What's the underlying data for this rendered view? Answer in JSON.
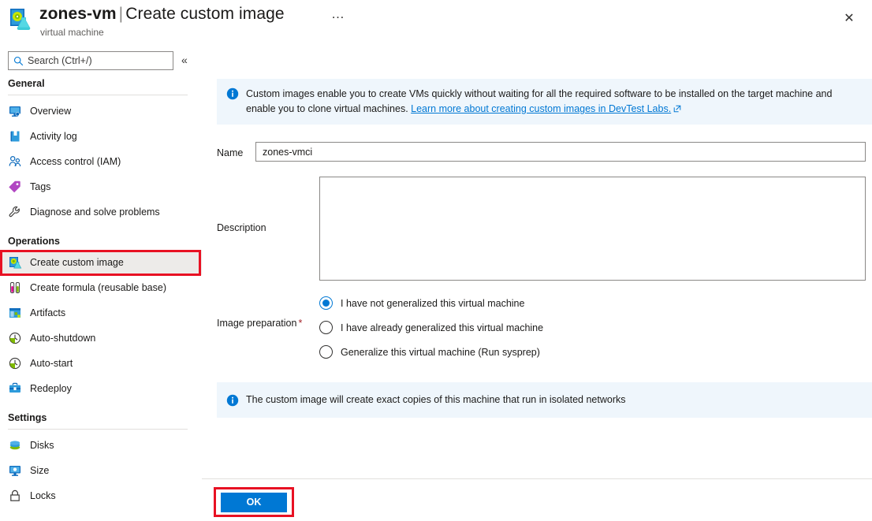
{
  "header": {
    "icon": "custom-image-icon",
    "vm_name": "zones-vm",
    "separator": "|",
    "blade_title": "Create custom image",
    "subtitle": "virtual machine",
    "ellipsis": "…",
    "close": "✕"
  },
  "sidebar": {
    "search": {
      "placeholder": "Search (Ctrl+/)",
      "value": "",
      "icon": "search-icon"
    },
    "collapse": {
      "glyph": "«",
      "name": "collapse-sidebar-button"
    },
    "groups": [
      {
        "title": "General",
        "items": [
          {
            "label": "Overview",
            "icon": "monitor-icon"
          },
          {
            "label": "Activity log",
            "icon": "book-icon"
          },
          {
            "label": "Access control (IAM)",
            "icon": "people-icon"
          },
          {
            "label": "Tags",
            "icon": "tag-icon"
          },
          {
            "label": "Diagnose and solve problems",
            "icon": "wrench-icon"
          }
        ]
      },
      {
        "title": "Operations",
        "items": [
          {
            "label": "Create custom image",
            "icon": "custom-image-icon",
            "selected": true,
            "highlighted": true
          },
          {
            "label": "Create formula (reusable base)",
            "icon": "test-tubes-icon"
          },
          {
            "label": "Artifacts",
            "icon": "artifacts-icon"
          },
          {
            "label": "Auto-shutdown",
            "icon": "clock-icon"
          },
          {
            "label": "Auto-start",
            "icon": "clock-icon"
          },
          {
            "label": "Redeploy",
            "icon": "toolbox-icon"
          }
        ]
      },
      {
        "title": "Settings",
        "items": [
          {
            "label": "Disks",
            "icon": "disks-icon"
          },
          {
            "label": "Size",
            "icon": "monitor-icon"
          },
          {
            "label": "Locks",
            "icon": "lock-icon"
          }
        ]
      }
    ]
  },
  "main": {
    "info_banner_top": {
      "icon": "info-icon",
      "text": "Custom images enable you to create VMs quickly without waiting for all the required software to be installed on the target machine and enable you to clone virtual machines. ",
      "link_text": "Learn more about creating custom images in DevTest Labs.",
      "link_icon": "external-link-icon"
    },
    "name_field": {
      "label": "Name",
      "value": "zones-vmci",
      "placeholder": ""
    },
    "description_field": {
      "label": "Description",
      "value": "",
      "placeholder": ""
    },
    "image_preparation": {
      "label": "Image preparation",
      "required_marker": "*",
      "options": [
        {
          "label": "I have not generalized this virtual machine",
          "selected": true
        },
        {
          "label": "I have already generalized this virtual machine",
          "selected": false
        },
        {
          "label": "Generalize this virtual machine (Run sysprep)",
          "selected": false
        }
      ]
    },
    "info_banner_bottom": {
      "icon": "info-icon",
      "text": "The custom image will create exact copies of this machine that run in isolated networks"
    },
    "footer": {
      "ok_label": "OK"
    }
  },
  "colors": {
    "accent": "#0078d4",
    "highlight_red": "#e81123",
    "banner_bg": "#eff6fc",
    "selected_bg": "#edebe9"
  }
}
